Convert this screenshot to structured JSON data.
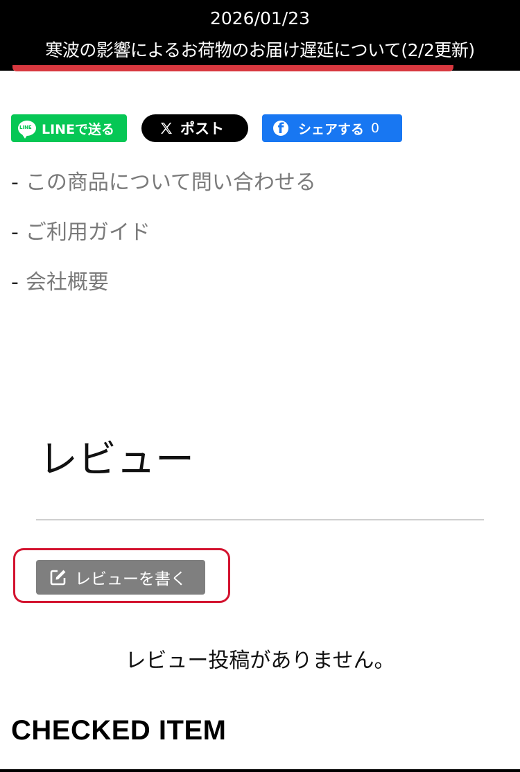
{
  "notice": {
    "date": "2026/01/23",
    "title": "寒波の影響によるお荷物のお届け遅延について(2/2更新)"
  },
  "share": {
    "line_label": "LINEで送る",
    "line_logo_text": "LINE",
    "x_label": "ポスト",
    "fb_label": "シェアする",
    "fb_count": "0"
  },
  "links": [
    {
      "dash": "-",
      "label": "この商品について問い合わせる"
    },
    {
      "dash": "-",
      "label": "ご利用ガイド"
    },
    {
      "dash": "-",
      "label": "会社概要"
    }
  ],
  "review": {
    "title": "レビュー",
    "write_button": "レビューを書く",
    "empty_message": "レビュー投稿がありません。"
  },
  "checked_item": {
    "heading": "CHECKED ITEM"
  },
  "colors": {
    "notice_bg": "#000000",
    "line_green": "#06c755",
    "fb_blue": "#1877f2",
    "highlight_red": "#d3132f",
    "button_gray": "#7f7f7f"
  },
  "icons": {
    "line": "line-logo-icon",
    "x": "x-logo-icon",
    "facebook": "facebook-icon",
    "edit": "edit-icon"
  }
}
